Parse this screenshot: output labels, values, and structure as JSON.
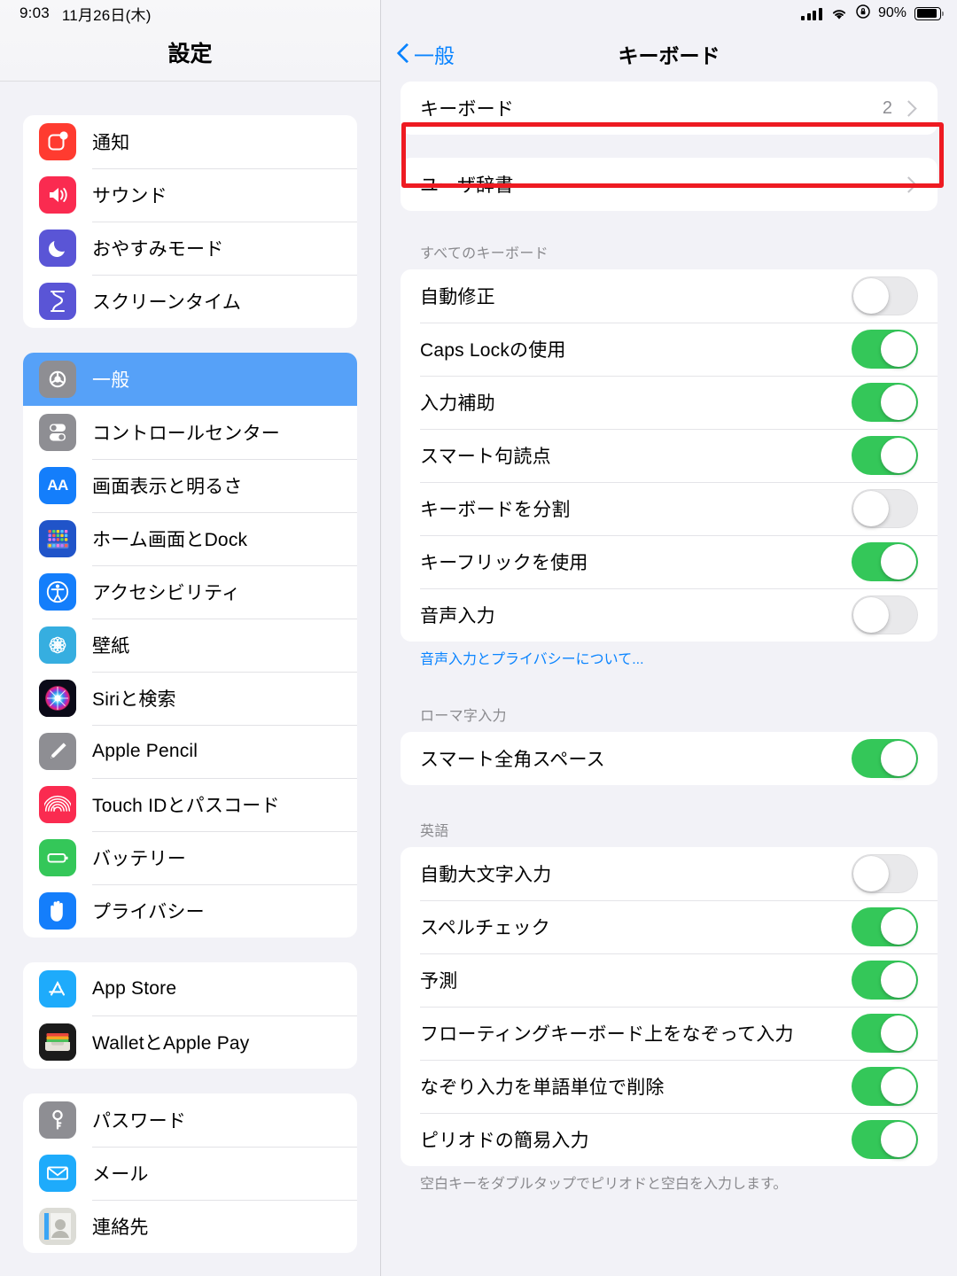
{
  "status_bar": {
    "time": "9:03",
    "date": "11月26日(木)",
    "battery_percent": "90%",
    "icons": [
      "cellular-signal-icon",
      "wifi-icon",
      "rotation-lock-icon",
      "battery-icon"
    ]
  },
  "sidebar": {
    "title": "設定",
    "groups": [
      {
        "items": [
          {
            "label": "通知",
            "icon": "notifications-icon",
            "selected": false
          },
          {
            "label": "サウンド",
            "icon": "sound-icon",
            "selected": false
          },
          {
            "label": "おやすみモード",
            "icon": "do-not-disturb-icon",
            "selected": false
          },
          {
            "label": "スクリーンタイム",
            "icon": "screen-time-icon",
            "selected": false
          }
        ]
      },
      {
        "items": [
          {
            "label": "一般",
            "icon": "general-gear-icon",
            "selected": true
          },
          {
            "label": "コントロールセンター",
            "icon": "control-center-icon",
            "selected": false
          },
          {
            "label": "画面表示と明るさ",
            "icon": "display-brightness-icon",
            "selected": false
          },
          {
            "label": "ホーム画面とDock",
            "icon": "home-screen-dock-icon",
            "selected": false
          },
          {
            "label": "アクセシビリティ",
            "icon": "accessibility-icon",
            "selected": false
          },
          {
            "label": "壁紙",
            "icon": "wallpaper-icon",
            "selected": false
          },
          {
            "label": "Siriと検索",
            "icon": "siri-icon",
            "selected": false
          },
          {
            "label": "Apple Pencil",
            "icon": "apple-pencil-icon",
            "selected": false
          },
          {
            "label": "Touch IDとパスコード",
            "icon": "touch-id-icon",
            "selected": false
          },
          {
            "label": "バッテリー",
            "icon": "battery-settings-icon",
            "selected": false
          },
          {
            "label": "プライバシー",
            "icon": "privacy-icon",
            "selected": false
          }
        ]
      },
      {
        "items": [
          {
            "label": "App Store",
            "icon": "app-store-icon",
            "selected": false
          },
          {
            "label": "WalletとApple Pay",
            "icon": "wallet-icon",
            "selected": false
          }
        ]
      },
      {
        "items": [
          {
            "label": "パスワード",
            "icon": "passwords-key-icon",
            "selected": false
          },
          {
            "label": "メール",
            "icon": "mail-icon",
            "selected": false
          },
          {
            "label": "連絡先",
            "icon": "contacts-icon",
            "selected": false
          }
        ]
      }
    ]
  },
  "detail": {
    "back_label": "一般",
    "title": "キーボード",
    "keyboards_row": {
      "label": "キーボード",
      "value": "2"
    },
    "user_dictionary_row": {
      "label": "ユーザ辞書"
    },
    "sections": [
      {
        "header": "すべてのキーボード",
        "rows": [
          {
            "label": "自動修正",
            "on": false
          },
          {
            "label": "Caps Lockの使用",
            "on": true
          },
          {
            "label": "入力補助",
            "on": true
          },
          {
            "label": "スマート句読点",
            "on": true
          },
          {
            "label": "キーボードを分割",
            "on": false
          },
          {
            "label": "キーフリックを使用",
            "on": true
          },
          {
            "label": "音声入力",
            "on": false
          }
        ],
        "footnote": "音声入力とプライバシーについて...",
        "footnote_is_link": true
      },
      {
        "header": "ローマ字入力",
        "rows": [
          {
            "label": "スマート全角スペース",
            "on": true
          }
        ],
        "footnote": "",
        "footnote_is_link": false
      },
      {
        "header": "英語",
        "rows": [
          {
            "label": "自動大文字入力",
            "on": false
          },
          {
            "label": "スペルチェック",
            "on": true
          },
          {
            "label": "予測",
            "on": true
          },
          {
            "label": "フローティングキーボード上をなぞって入力",
            "on": true
          },
          {
            "label": "なぞり入力を単語単位で削除",
            "on": true
          },
          {
            "label": "ピリオドの簡易入力",
            "on": true
          }
        ],
        "footnote": "空白キーをダブルタップでピリオドと空白を入力します。",
        "footnote_is_link": false
      }
    ]
  },
  "annotation": {
    "highlight_color": "#ee1b22",
    "target": "キーボード"
  },
  "colors": {
    "accent_blue": "#0a84ff",
    "selected_row": "#56a1f8",
    "toggle_on": "#34c759",
    "toggle_off": "#e9e9eb",
    "background": "#f2f2f7"
  }
}
